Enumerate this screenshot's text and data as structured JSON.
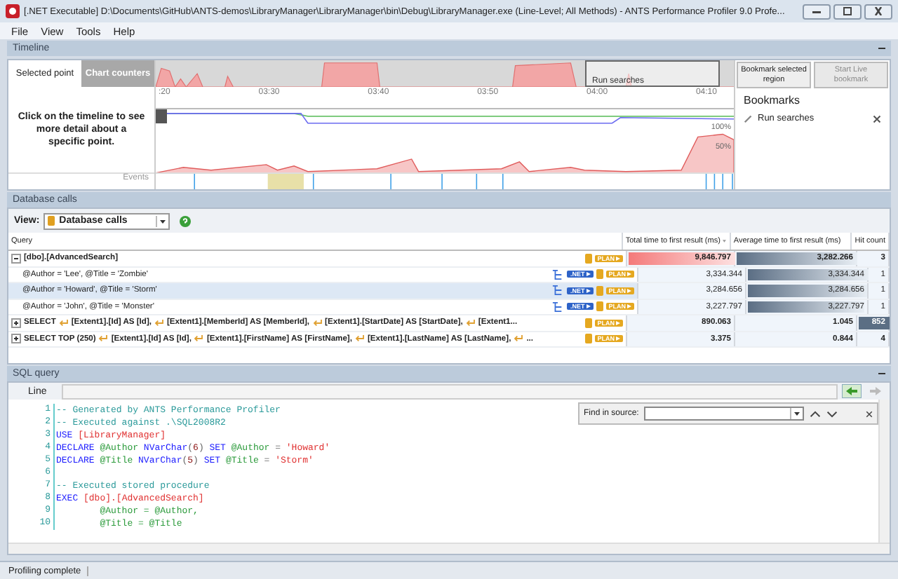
{
  "window": {
    "title": "[.NET Executable] D:\\Documents\\GitHub\\ANTS-demos\\LibraryManager\\LibraryManager\\bin\\Debug\\LibraryManager.exe (Line-Level; All Methods) - ANTS Performance Profiler 9.0 Profe..."
  },
  "menu": [
    "File",
    "View",
    "Tools",
    "Help"
  ],
  "timeline": {
    "header": "Timeline",
    "tabs": [
      {
        "label": "Selected point",
        "selected": true
      },
      {
        "label": "Chart counters",
        "selected": false
      }
    ],
    "region_label": "Run searches",
    "ticks": [
      ":20",
      "03:30",
      "03:40",
      "03:50",
      "04:00",
      "04:10"
    ],
    "scale_labels": [
      "100%",
      "50%"
    ],
    "hint": "Click on the timeline to see more detail about a specific point.",
    "events_label": "Events",
    "actions": [
      {
        "label": "Bookmark selected region",
        "disabled": false
      },
      {
        "label": "Start Live bookmark",
        "disabled": true
      }
    ],
    "bookmarks_title": "Bookmarks",
    "bookmarks": [
      "Run searches"
    ]
  },
  "database_calls": {
    "header": "Database calls",
    "view_label": "View:",
    "view_value": "Database calls",
    "columns": [
      {
        "label": "Query",
        "sorted": false
      },
      {
        "label": "Total time to first result (ms)",
        "sorted": true
      },
      {
        "label": "Average time to first result (ms)",
        "sorted": false
      },
      {
        "label": "Hit count",
        "sorted": false
      }
    ],
    "rows": [
      {
        "query": "[dbo].[AdvancedSearch]",
        "expanded": true,
        "selected": false,
        "badges": [
          {
            "kind": "plan",
            "text": "PLAN"
          }
        ],
        "total": {
          "text": "9,846.797",
          "level": 1
        },
        "average": {
          "text": "3,282.266",
          "level": 1
        },
        "hits": {
          "text": "3"
        },
        "children": [
          {
            "query": "@Author = 'Lee', @Title = 'Zombie'",
            "selected": false,
            "badges": [
              {
                "kind": "net",
                "text": ".NET"
              },
              {
                "kind": "plan",
                "text": "PLAN"
              }
            ],
            "total": {
              "text": "3,334.344"
            },
            "average": {
              "text": "3,334.344",
              "level": 1
            },
            "hits": {
              "text": "1"
            }
          },
          {
            "query": "@Author = 'Howard', @Title = 'Storm'",
            "selected": true,
            "badges": [
              {
                "kind": "net",
                "text": ".NET"
              },
              {
                "kind": "plan",
                "text": "PLAN"
              }
            ],
            "total": {
              "text": "3,284.656"
            },
            "average": {
              "text": "3,284.656",
              "level": 0.99
            },
            "hits": {
              "text": "1"
            }
          },
          {
            "query": "@Author = 'John', @Title = 'Monster'",
            "selected": false,
            "badges": [
              {
                "kind": "net",
                "text": ".NET"
              },
              {
                "kind": "plan",
                "text": "PLAN"
              }
            ],
            "total": {
              "text": "3,227.797"
            },
            "average": {
              "text": "3,227.797",
              "level": 0.97
            },
            "hits": {
              "text": "1"
            }
          }
        ]
      },
      {
        "query": "SELECT",
        "segments": [
          "[Extent1].[Id] AS [Id],",
          "[Extent1].[MemberId] AS [MemberId],",
          "[Extent1].[StartDate] AS [StartDate],",
          "[Extent1..."
        ],
        "expanded": false,
        "selected": false,
        "badges": [
          {
            "kind": "plan",
            "text": "PLAN"
          }
        ],
        "total": {
          "text": "890.063"
        },
        "average": {
          "text": "1.045"
        },
        "hits": {
          "text": "852",
          "level": 1
        }
      },
      {
        "query": "SELECT TOP (250)",
        "segments": [
          "[Extent1].[Id] AS [Id],",
          "[Extent1].[FirstName] AS [FirstName],",
          "[Extent1].[LastName] AS [LastName],",
          "..."
        ],
        "expanded": false,
        "selected": false,
        "badges": [
          {
            "kind": "plan",
            "text": "PLAN"
          }
        ],
        "total": {
          "text": "3.375"
        },
        "average": {
          "text": "0.844"
        },
        "hits": {
          "text": "4"
        }
      }
    ]
  },
  "sql_query": {
    "header": "SQL query",
    "line_label": "Line",
    "find_label": "Find in source:",
    "lines": [
      {
        "number": "1",
        "tokens": [
          {
            "kind": "comment",
            "text": "-- Generated by ANTS Performance Profiler"
          }
        ]
      },
      {
        "number": "2",
        "tokens": [
          {
            "kind": "comment",
            "text": "-- Executed against .\\SQL2008R2"
          }
        ]
      },
      {
        "number": "3",
        "tokens": [
          {
            "kind": "keyword",
            "text": "USE"
          },
          {
            "kind": "name",
            "text": " [LibraryManager]"
          }
        ]
      },
      {
        "number": "4",
        "tokens": [
          {
            "kind": "keyword",
            "text": "DECLARE"
          },
          {
            "kind": "variable",
            "text": " @Author"
          },
          {
            "kind": "keyword",
            "text": " NVarChar"
          },
          {
            "kind": "plain",
            "text": "("
          },
          {
            "kind": "number",
            "text": "6"
          },
          {
            "kind": "plain",
            "text": ")"
          },
          {
            "kind": "keyword",
            "text": " SET"
          },
          {
            "kind": "variable",
            "text": " @Author"
          },
          {
            "kind": "plain",
            "text": " = "
          },
          {
            "kind": "name",
            "text": "'Howard'"
          }
        ]
      },
      {
        "number": "5",
        "tokens": [
          {
            "kind": "keyword",
            "text": "DECLARE"
          },
          {
            "kind": "variable",
            "text": " @Title"
          },
          {
            "kind": "keyword",
            "text": " NVarChar"
          },
          {
            "kind": "plain",
            "text": "("
          },
          {
            "kind": "number",
            "text": "5"
          },
          {
            "kind": "plain",
            "text": ")"
          },
          {
            "kind": "keyword",
            "text": " SET"
          },
          {
            "kind": "variable",
            "text": " @Title"
          },
          {
            "kind": "plain",
            "text": " = "
          },
          {
            "kind": "name",
            "text": "'Storm'"
          }
        ]
      },
      {
        "number": "6"
      },
      {
        "number": "7",
        "tokens": [
          {
            "kind": "comment",
            "text": "-- Executed stored procedure"
          }
        ]
      },
      {
        "number": "8",
        "tokens": [
          {
            "kind": "keyword",
            "text": "EXEC"
          },
          {
            "kind": "name",
            "text": " [dbo].[AdvancedSearch]"
          }
        ]
      },
      {
        "number": "9",
        "tokens": [
          {
            "kind": "variable",
            "text": "        @Author = @Author,"
          }
        ]
      },
      {
        "number": "10",
        "tokens": [
          {
            "kind": "variable",
            "text": "        @Title = @Title"
          }
        ]
      }
    ]
  },
  "status_bar": "Profiling complete"
}
